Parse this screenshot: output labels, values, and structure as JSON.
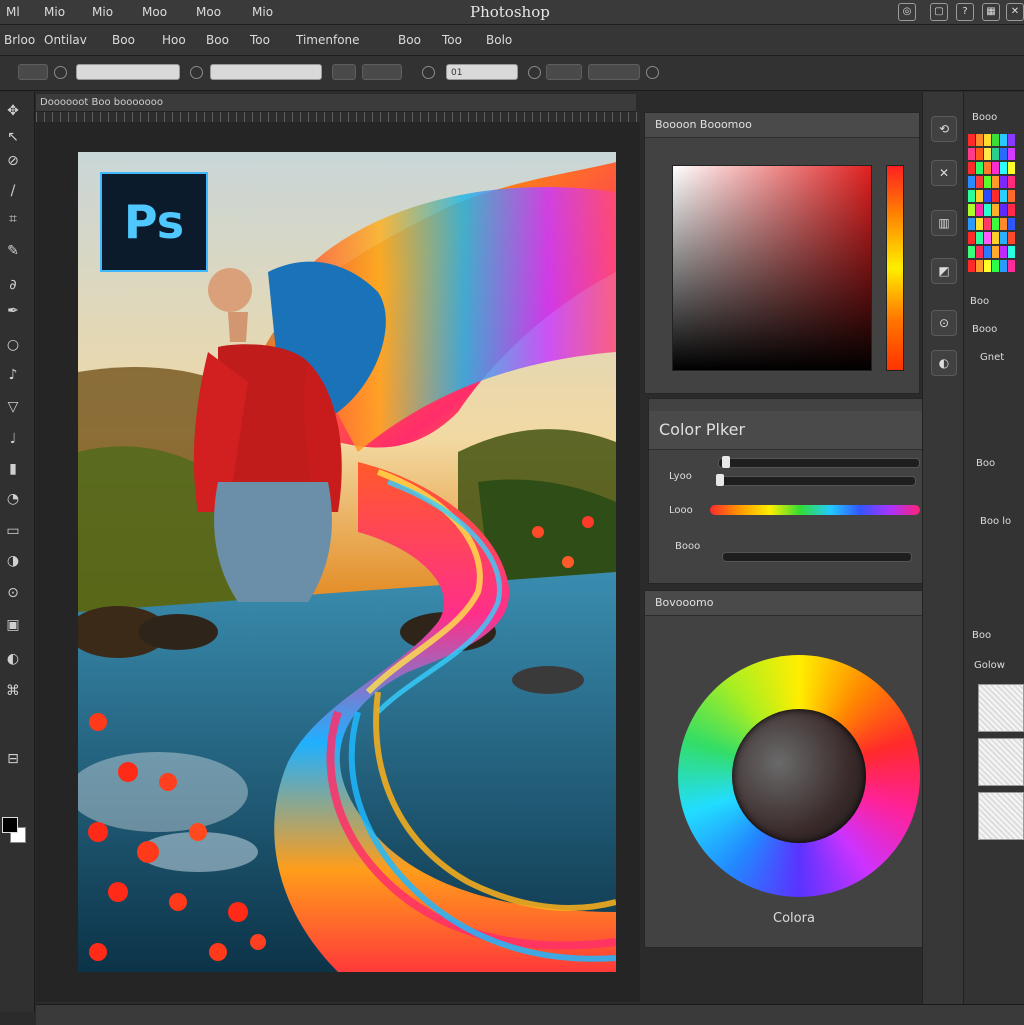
{
  "app": {
    "title": "Photoshop"
  },
  "menubar": {
    "items": [
      "Ml",
      "Mio",
      "Mio",
      "Moo",
      "Moo",
      "Mio"
    ]
  },
  "menubar2": {
    "items": [
      "Brloo",
      "Ontilav",
      "Boo",
      "Hoo",
      "Boo",
      "Too",
      "Timenfone",
      "Boo",
      "Too",
      "Bolo"
    ]
  },
  "options": {
    "fields": [
      "",
      "",
      "",
      "",
      "",
      "",
      "",
      "01",
      "",
      "",
      ""
    ]
  },
  "document": {
    "tab": "Doooooot Boo booooooo",
    "logo_text": "Ps"
  },
  "panels": {
    "gradient": {
      "title": "Boooon   Booomoo"
    },
    "color_picker": {
      "title": "Color Plker",
      "rows": [
        "Lyoo",
        "Looo",
        "Booo"
      ]
    },
    "color_wheel": {
      "title": "Bovooomo",
      "label": "Colora"
    }
  },
  "right_column": {
    "swatches_title": "Booo",
    "labels": [
      "Boo",
      "Booo",
      "Gnet",
      "Boo",
      "Boo lo",
      "Boo",
      "Golow"
    ]
  },
  "colors": {
    "accent": "#3fb8ff",
    "panel": "#424242",
    "background": "#2b2b2b"
  }
}
